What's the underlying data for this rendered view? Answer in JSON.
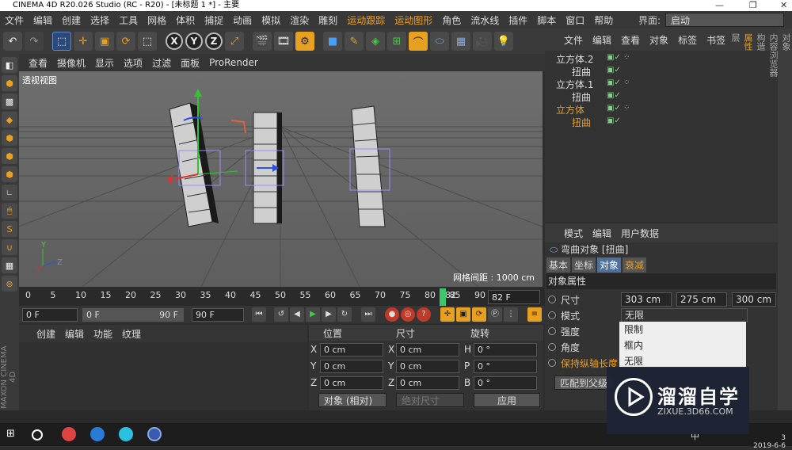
{
  "window": {
    "title": "CINEMA 4D R20.026 Studio (RC - R20) - [未标题 1 *] - 主要"
  },
  "menu": [
    "文件",
    "编辑",
    "创建",
    "选择",
    "工具",
    "网格",
    "体积",
    "捕捉",
    "动画",
    "模拟",
    "渲染",
    "雕刻",
    "运动跟踪",
    "运动图形",
    "角色",
    "流水线",
    "插件",
    "脚本",
    "窗口",
    "帮助"
  ],
  "menu_highlight": [
    "运动跟踪",
    "运动图形"
  ],
  "interface": {
    "label": "界面:",
    "value": "启动"
  },
  "toolbar_icons": [
    "undo-icon",
    "redo-icon",
    "select-icon",
    "move-icon",
    "scale-icon",
    "rotate-icon",
    "recent-tool-icon",
    "x-axis-icon",
    "y-axis-icon",
    "z-axis-icon",
    "coord-system-icon",
    "render-view-icon",
    "render-picture-icon",
    "render-settings-icon",
    "cube-icon",
    "pen-icon",
    "subdivision-icon",
    "array-icon",
    "bend-icon",
    "floor-icon",
    "camera-icon",
    "light-icon"
  ],
  "xyz": [
    "X",
    "Y",
    "Z"
  ],
  "viewport": {
    "menu": [
      "查看",
      "摄像机",
      "显示",
      "选项",
      "过滤",
      "面板",
      "ProRender"
    ],
    "label": "透视视图",
    "grid_distance": "网格间距 : 1000 cm",
    "axis_labels": {
      "y": "Y",
      "z": "Z"
    }
  },
  "timeline": {
    "ticks": [
      "0",
      "5",
      "10",
      "15",
      "20",
      "25",
      "30",
      "35",
      "40",
      "45",
      "50",
      "55",
      "60",
      "65",
      "70",
      "75",
      "80",
      "85",
      "90"
    ],
    "current_marker": "82",
    "frame_field": "82 F"
  },
  "playback": {
    "start": "0 F",
    "slider_start": "0 F",
    "slider_end": "90 F",
    "end": "90 F"
  },
  "material": {
    "menu": [
      "创建",
      "编辑",
      "功能",
      "纹理"
    ]
  },
  "coordinates": {
    "headers": [
      "位置",
      "尺寸",
      "旋转"
    ],
    "rows": [
      {
        "pos_label": "X",
        "pos": "0 cm",
        "size_label": "X",
        "size": "0 cm",
        "rot_label": "H",
        "rot": "0 °"
      },
      {
        "pos_label": "Y",
        "pos": "0 cm",
        "size_label": "Y",
        "size": "0 cm",
        "rot_label": "P",
        "rot": "0 °"
      },
      {
        "pos_label": "Z",
        "pos": "0 cm",
        "size_label": "Z",
        "size": "0 cm",
        "rot_label": "B",
        "rot": "0 °"
      }
    ],
    "mode": "对象 (相对)",
    "size_mode": "绝对尺寸",
    "apply": "应用"
  },
  "object_manager": {
    "menu": [
      "文件",
      "编辑",
      "查看",
      "对象",
      "标签",
      "书签"
    ],
    "objects": [
      {
        "name": "立方体.2",
        "child": "扭曲",
        "active": false
      },
      {
        "name": "立方体.1",
        "child": "扭曲",
        "active": false
      },
      {
        "name": "立方体",
        "child": "扭曲",
        "active": true
      }
    ]
  },
  "attribute_manager": {
    "menu": [
      "模式",
      "编辑",
      "用户数据"
    ],
    "title": "弯曲对象 [扭曲]",
    "tabs": [
      "基本",
      "坐标",
      "对象",
      "衰减"
    ],
    "section": "对象属性",
    "size_label": "尺寸",
    "size_values": [
      "303 cm",
      "275 cm",
      "300 cm"
    ],
    "mode_label": "模式",
    "mode_value": "无限",
    "strength_label": "强度",
    "angle_label": "角度",
    "keep_label": "保持纵轴长度",
    "match_parent": "匹配到父级",
    "dropdown_options": [
      "限制",
      "框内",
      "无限"
    ]
  },
  "right_tabs": [
    "对象",
    "内容浏览器",
    "构造",
    "属性",
    "层"
  ],
  "side_brand": "MAXON CINEMA 4D",
  "taskbar": {
    "time_tail": "3",
    "date": "2019-6-6",
    "ime": "中"
  },
  "watermark": {
    "brand": "溜溜自学",
    "url": "ZIXUE.3D66.COM"
  },
  "colors": {
    "accent": "#e8a020",
    "viewport": "#5c5c5c",
    "frame": "#3cc86a"
  }
}
